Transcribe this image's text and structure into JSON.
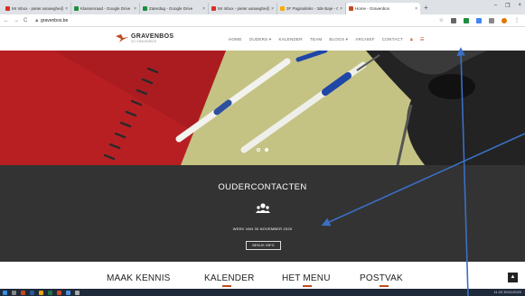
{
  "browser": {
    "tabs": [
      {
        "title": "Mr Inbox - pieter.vanaeghe@gra...",
        "color": "#d93025",
        "active": false
      },
      {
        "title": "Klassenraad - Google Drive",
        "color": "#1e8e3e",
        "active": false
      },
      {
        "title": "Zaterdag - Google Drive",
        "color": "#1e8e3e",
        "active": false
      },
      {
        "title": "Mr Inbox - pieter.vanaeghe@gra...",
        "color": "#d93025",
        "active": false
      },
      {
        "title": "3F Paginalinks - 3de Baje - Go...",
        "color": "#f9ab00",
        "active": false
      },
      {
        "title": "Home - Gravenbos",
        "color": "#c24a1c",
        "active": true
      }
    ],
    "new_tab_label": "+",
    "window_controls": [
      "–",
      "❐",
      "×"
    ],
    "nav_glyphs": [
      "←",
      "→",
      "C"
    ],
    "url": "gravenbos.be"
  },
  "site": {
    "logo_name": "GRAVENBOS",
    "logo_sub": "SO GRAVENBOS",
    "nav": [
      "HOME",
      "OUDERS ▾",
      "KALENDER",
      "TEAM",
      "BLOGS ▾",
      "ARCHIEF",
      "CONTACT"
    ],
    "hero_dots": [
      false,
      true
    ],
    "section_title": "OUDERCONTACTEN",
    "section_text": "WEEK VAN 30 NOVEMBER 2020",
    "section_button": "BEKIJK INFO",
    "bottom_nav": [
      "MAAK KENNIS",
      "KALENDER",
      "HET MENU",
      "POSTVAK"
    ],
    "to_top_label": "▲"
  },
  "colors": {
    "accent": "#c24a1c",
    "dark_section": "#333333",
    "arrow": "#3b6fc4"
  },
  "taskbar": {
    "tray": "11:23 30/11/2020"
  }
}
